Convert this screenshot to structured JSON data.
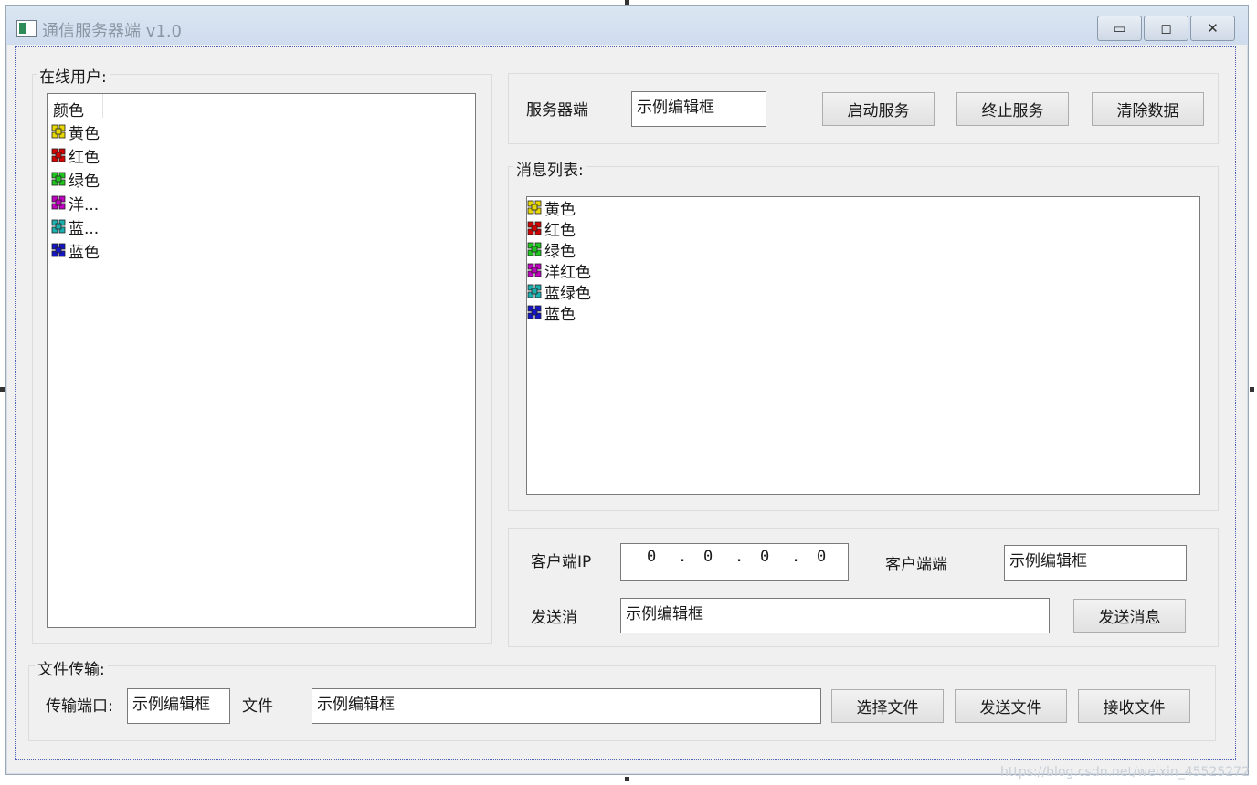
{
  "window": {
    "title": "通信服务器端 v1.0",
    "controls": {
      "minimize": "▭",
      "maximize": "◻",
      "close": "✕"
    }
  },
  "online_users": {
    "group_title": "在线用户:",
    "column_header": "颜色",
    "items": [
      {
        "label": "黄色",
        "color": "#e6d800"
      },
      {
        "label": "红色",
        "color": "#d40000"
      },
      {
        "label": "绿色",
        "color": "#1ec81e"
      },
      {
        "label": "洋...",
        "color": "#c000c0"
      },
      {
        "label": "蓝...",
        "color": "#1ab0b0"
      },
      {
        "label": "蓝色",
        "color": "#1414c8"
      }
    ]
  },
  "server": {
    "label": "服务器端",
    "port_value": "示例编辑框",
    "start_button": "启动服务",
    "stop_button": "终止服务",
    "clear_button": "清除数据"
  },
  "messages": {
    "group_title": "消息列表:",
    "items": [
      {
        "label": "黄色",
        "color": "#e6d800"
      },
      {
        "label": "红色",
        "color": "#d40000"
      },
      {
        "label": "绿色",
        "color": "#1ec81e"
      },
      {
        "label": "洋红色",
        "color": "#c000c0"
      },
      {
        "label": "蓝绿色",
        "color": "#1ab0b0"
      },
      {
        "label": "蓝色",
        "color": "#1414c8"
      }
    ]
  },
  "client": {
    "ip_label": "客户端IP",
    "ip_octets": [
      "0",
      "0",
      "0",
      "0"
    ],
    "port_label": "客户端端",
    "port_value": "示例编辑框",
    "send_label": "发送消",
    "send_value": "示例编辑框",
    "send_button": "发送消息"
  },
  "file_transfer": {
    "group_title": "文件传输:",
    "port_label": "传输端口:",
    "port_value": "示例编辑框",
    "file_label": "文件",
    "file_value": "示例编辑框",
    "choose_button": "选择文件",
    "send_button": "发送文件",
    "receive_button": "接收文件"
  },
  "watermark": "https://blog.csdn.net/weixin_45525272"
}
